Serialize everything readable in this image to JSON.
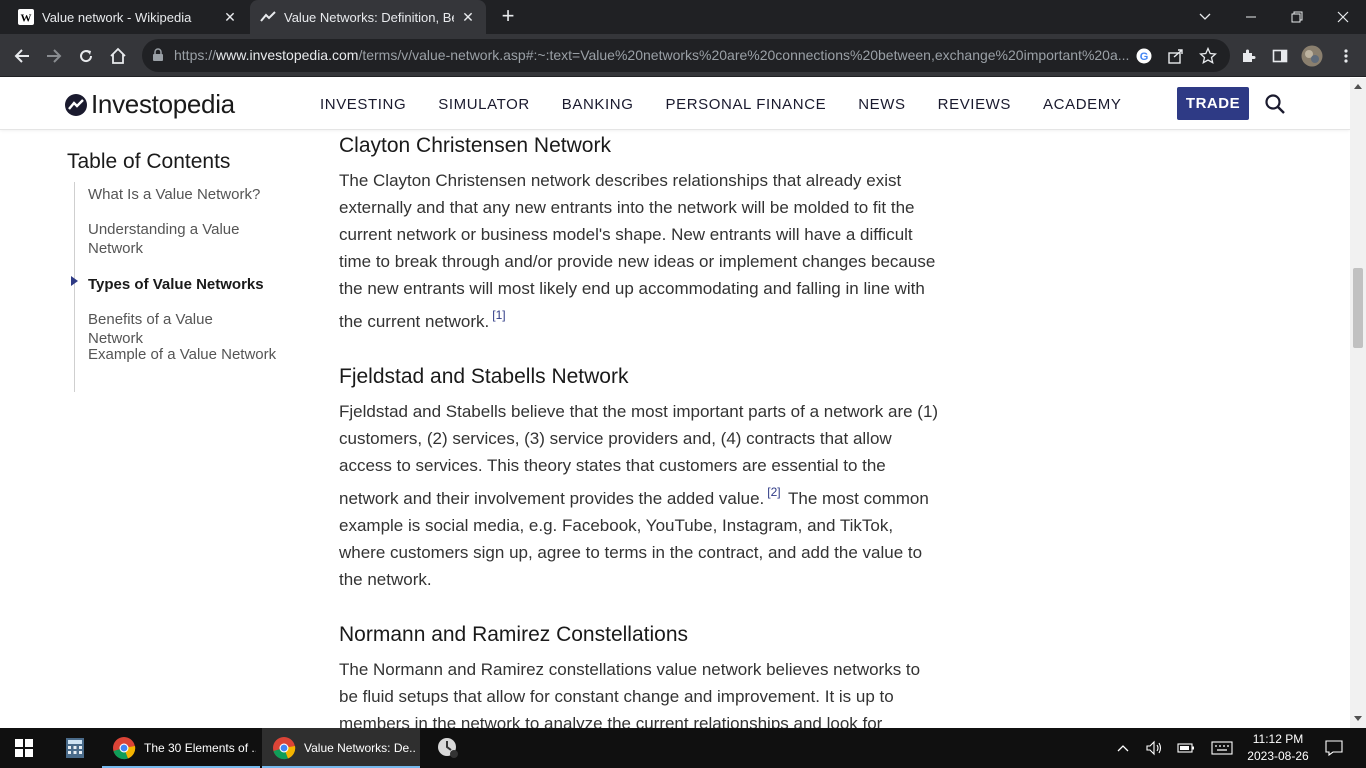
{
  "browser": {
    "tabs": [
      {
        "title": "Value network - Wikipedia",
        "favicon": "wikipedia-icon"
      },
      {
        "title": "Value Networks: Definition, Benefits",
        "favicon": "investopedia-icon"
      }
    ],
    "url_prefix": "https://",
    "url_domain": "www.investopedia.com",
    "url_path": "/terms/v/value-network.asp#:~:text=Value%20networks%20are%20connections%20between,exchange%20important%20a..."
  },
  "site": {
    "logo_text": "Investopedia",
    "nav": [
      "INVESTING",
      "SIMULATOR",
      "BANKING",
      "PERSONAL FINANCE",
      "NEWS",
      "REVIEWS",
      "ACADEMY"
    ],
    "trade_label": "TRADE"
  },
  "toc": {
    "title": "Table of Contents",
    "items": [
      {
        "label": "What Is a Value Network?"
      },
      {
        "label": "Understanding a Value Network"
      },
      {
        "label": "Types of Value Networks"
      },
      {
        "label": "Benefits of a Value Network"
      },
      {
        "label": "Example of a Value Network"
      }
    ]
  },
  "article": {
    "sections": [
      {
        "heading": "Clayton Christensen Network",
        "body": "The Clayton Christensen network describes relationships that already exist externally and that any new entrants into the network will be molded to fit the current network or business model's shape. New entrants will have a difficult time to break through and/or provide new ideas or implement changes because the new entrants will most likely end up accommodating and falling in line with the current network.",
        "citation": "[1]"
      },
      {
        "heading": "Fjeldstad and Stabells Network",
        "body_before": "Fjeldstad and Stabells believe that the most important parts of a network are (1) customers, (2) services, (3) service providers and, (4) contracts that allow access to services. This theory states that customers are essential to the network and their involvement provides the added value.",
        "citation": "[2]",
        "body_after": "The most common example is social media, e.g. Facebook, YouTube, Instagram, and TikTok, where customers sign up, agree to terms in the contract, and add the value to the network."
      },
      {
        "heading": "Normann and Ramirez Constellations",
        "body": "The Normann and Ramirez constellations value network believes networks to be fluid setups that allow for constant change and improvement. It is up to members in the network to analyze the current relationships and look for"
      }
    ]
  },
  "taskbar": {
    "apps": [
      {
        "title": "The 30 Elements of ..."
      },
      {
        "title": "Value Networks: De..."
      }
    ],
    "time": "11:12 PM",
    "date": "2023-08-26"
  }
}
